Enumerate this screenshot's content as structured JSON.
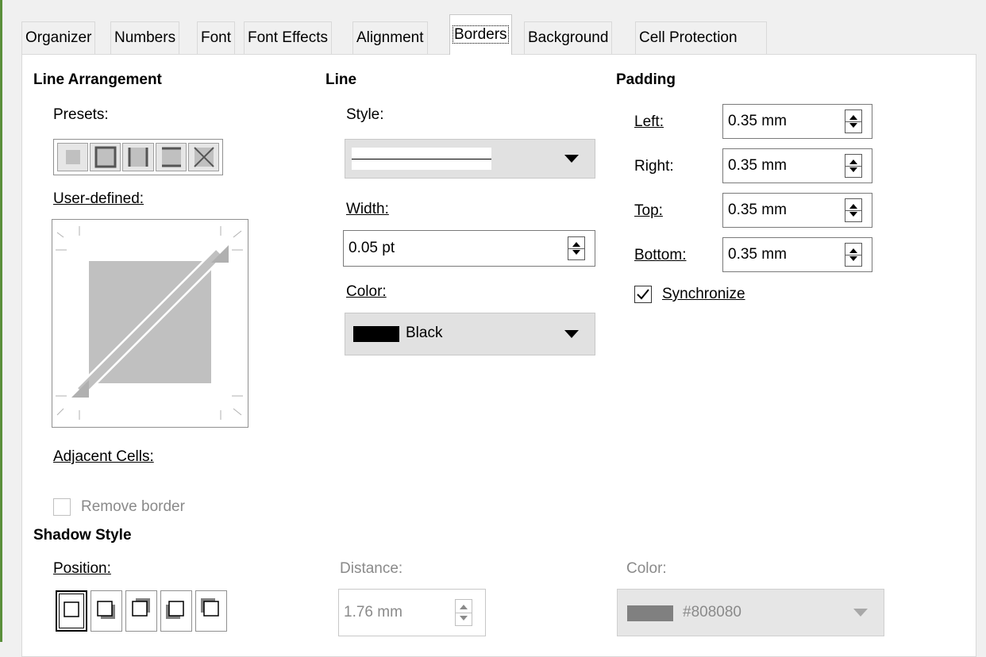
{
  "tabs": [
    "Organizer",
    "Numbers",
    "Font",
    "Font Effects",
    "Alignment",
    "Borders",
    "Background",
    "Cell Protection"
  ],
  "active_tab": "Borders",
  "line_arrangement": {
    "heading": "Line Arrangement",
    "presets_label": "Presets:",
    "user_defined_label": "User-defined:",
    "adjacent_cells_label": "Adjacent Cells:",
    "remove_border_label": "Remove border"
  },
  "line": {
    "heading": "Line",
    "style_label": "Style:",
    "width_label": "Width:",
    "width_value": "0.05 pt",
    "color_label": "Color:",
    "color_value": "Black",
    "color_swatch": "#000000"
  },
  "padding": {
    "heading": "Padding",
    "left_label": "Left:",
    "left_value": "0.35 mm",
    "right_label": "Right:",
    "right_value": "0.35 mm",
    "top_label": "Top:",
    "top_value": "0.35 mm",
    "bottom_label": "Bottom:",
    "bottom_value": "0.35 mm",
    "synchronize_label": "Synchronize",
    "synchronize_checked": true
  },
  "shadow": {
    "heading": "Shadow Style",
    "position_label": "Position:",
    "distance_label": "Distance:",
    "distance_value": "1.76 mm",
    "color_label": "Color:",
    "color_value": "#808080",
    "color_swatch": "#808080"
  }
}
